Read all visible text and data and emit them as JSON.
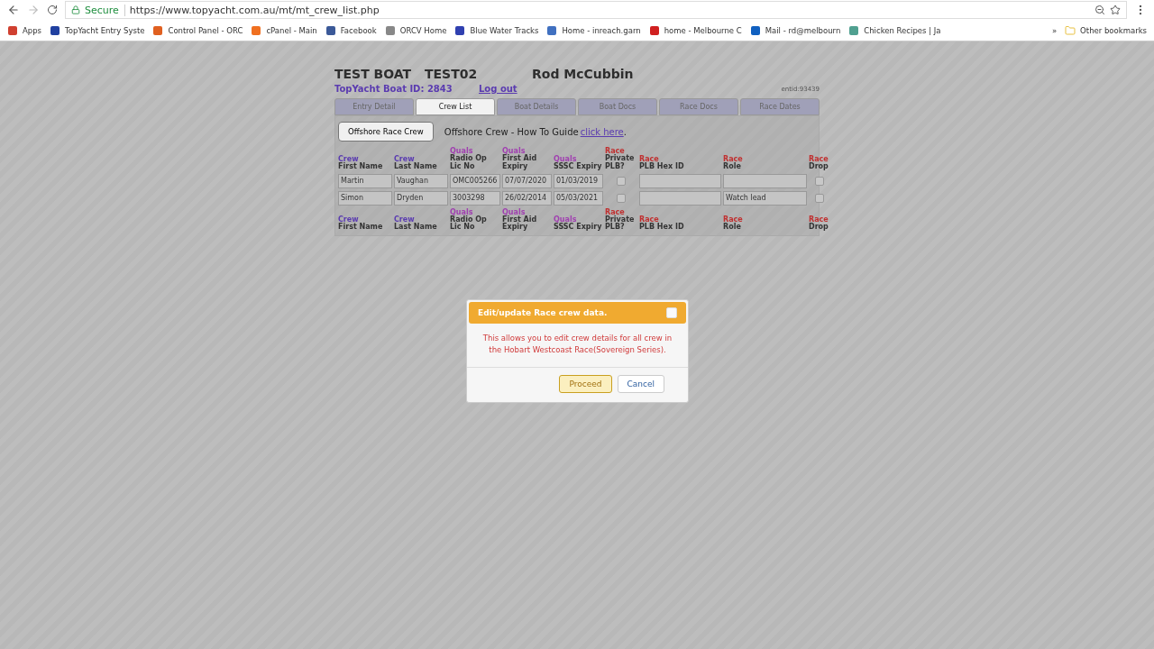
{
  "browser": {
    "secure_label": "Secure",
    "url": "https://www.topyacht.com.au/mt/mt_crew_list.php",
    "bookmarks": [
      {
        "label": "Apps",
        "color": "#d04030"
      },
      {
        "label": "TopYacht Entry Syste",
        "color": "#2040a0"
      },
      {
        "label": "Control Panel - ORC",
        "color": "#e06020"
      },
      {
        "label": "cPanel - Main",
        "color": "#f07020"
      },
      {
        "label": "Facebook",
        "color": "#3b5998"
      },
      {
        "label": "ORCV Home",
        "color": "#888888"
      },
      {
        "label": "Blue Water Tracks",
        "color": "#3040b0"
      },
      {
        "label": "Home - inreach.garn",
        "color": "#4070c0"
      },
      {
        "label": "home - Melbourne C",
        "color": "#d02020"
      },
      {
        "label": "Mail - rd@melbourn",
        "color": "#1060c0"
      },
      {
        "label": "Chicken Recipes | Ja",
        "color": "#50a090"
      }
    ],
    "more_label": "»",
    "other_bookmarks": "Other bookmarks"
  },
  "header": {
    "boat_name": "TEST BOAT",
    "boat_code": "TEST02",
    "skipper": "Rod McCubbin",
    "boat_id": "TopYacht Boat ID: 2843",
    "logout": "Log out",
    "entry_id": "entid:93439"
  },
  "tabs": [
    {
      "label": "Entry Detail",
      "selected": false
    },
    {
      "label": "Crew List",
      "selected": true
    },
    {
      "label": "Boat Details",
      "selected": false
    },
    {
      "label": "Boat Docs",
      "selected": false
    },
    {
      "label": "Race Docs",
      "selected": false
    },
    {
      "label": "Race Dates",
      "selected": false
    }
  ],
  "toolbar": {
    "button": "Offshore Race Crew",
    "guide_text": "Offshore Crew - How To Guide",
    "guide_link": "click here",
    "guide_suffix": "."
  },
  "table": {
    "header_top": [
      {
        "kind": "crew",
        "group": "Crew",
        "label": "First Name"
      },
      {
        "kind": "crew",
        "group": "Crew",
        "label": "Last Name"
      },
      {
        "kind": "quals",
        "group": "Quals",
        "label": "Radio Op Lic No"
      },
      {
        "kind": "quals",
        "group": "Quals",
        "label": "First Aid Expiry"
      },
      {
        "kind": "quals",
        "group": "Quals",
        "label": "SSSC Expiry"
      },
      {
        "kind": "race",
        "group": "Race",
        "label": "Private PLB?"
      },
      {
        "kind": "race",
        "group": "Race",
        "label": "PLB Hex ID"
      },
      {
        "kind": "race",
        "group": "Race",
        "label": "Role"
      },
      {
        "kind": "race",
        "group": "Race",
        "label": "Drop"
      }
    ],
    "rows": [
      [
        {
          "kind": "input",
          "value": "Martin"
        },
        {
          "kind": "input",
          "value": "Vaughan"
        },
        {
          "kind": "input",
          "value": "OMC005266"
        },
        {
          "kind": "input",
          "value": "07/07/2020"
        },
        {
          "kind": "input",
          "value": "01/03/2019"
        },
        {
          "kind": "checkbox",
          "checked": false
        },
        {
          "kind": "input"
        },
        {
          "kind": "input"
        },
        {
          "kind": "checkbox",
          "checked": false
        }
      ],
      [
        {
          "kind": "input",
          "value": "Simon"
        },
        {
          "kind": "input",
          "value": "Dryden"
        },
        {
          "kind": "input",
          "value": "3003298"
        },
        {
          "kind": "input",
          "value": "26/02/2014"
        },
        {
          "kind": "input",
          "value": "05/03/2021"
        },
        {
          "kind": "checkbox",
          "checked": false
        },
        {
          "kind": "input"
        },
        {
          "kind": "input",
          "value": "Watch lead"
        },
        {
          "kind": "checkbox",
          "checked": false
        }
      ]
    ],
    "header_bottom": [
      {
        "kind": "crew",
        "group": "Crew",
        "label": "First Name"
      },
      {
        "kind": "crew",
        "group": "Crew",
        "label": "Last Name"
      },
      {
        "kind": "quals",
        "group": "Quals",
        "label": "Radio Op Lic No"
      },
      {
        "kind": "quals",
        "group": "Quals",
        "label": "First Aid Expiry"
      },
      {
        "kind": "quals",
        "group": "Quals",
        "label": "SSSC Expiry"
      },
      {
        "kind": "race",
        "group": "Race",
        "label": "Private PLB?"
      },
      {
        "kind": "race",
        "group": "Race",
        "label": "PLB Hex ID"
      },
      {
        "kind": "race",
        "group": "Race",
        "label": "Role"
      },
      {
        "kind": "race",
        "group": "Race",
        "label": "Drop"
      }
    ]
  },
  "dialog": {
    "title": "Edit/update Race crew data.",
    "message": "This allows you to edit crew details for all crew in the Hobart Westcoast Race(Sovereign Series).",
    "buttons": [
      {
        "label": "Proceed",
        "highlighted": true
      },
      {
        "label": "Cancel",
        "highlighted": false
      }
    ]
  }
}
